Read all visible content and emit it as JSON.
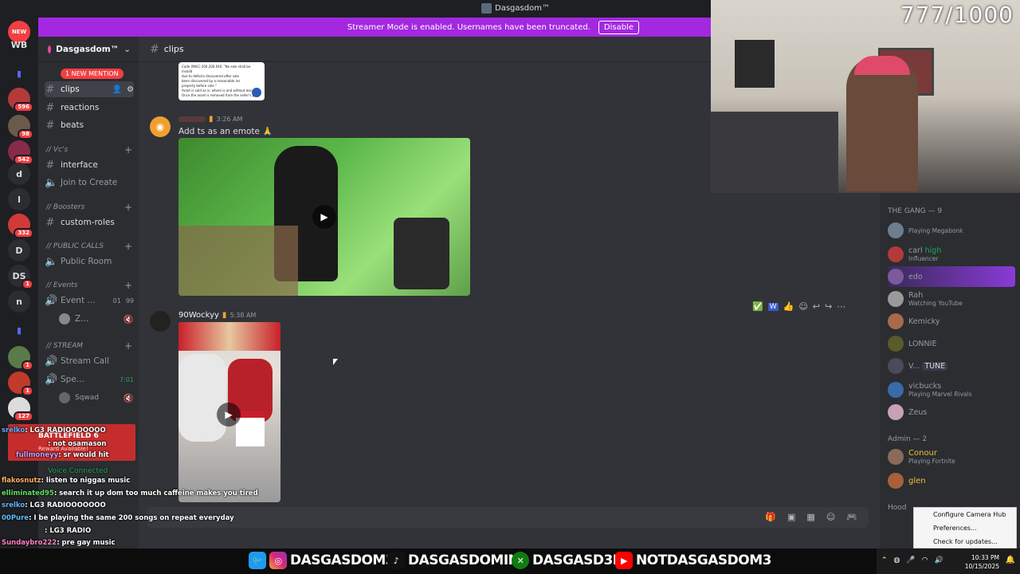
{
  "titlebar": {
    "title": "Dasgasdom™"
  },
  "banner": {
    "text": "Streamer Mode is enabled. Usernames have been truncated.",
    "button": "Disable"
  },
  "rail": {
    "new_label": "NEW",
    "items": [
      {
        "label": "WB",
        "badge": ""
      },
      {
        "label": "",
        "badge": "596"
      },
      {
        "label": "",
        "badge": "98"
      },
      {
        "label": "",
        "badge": "542"
      },
      {
        "label": "d",
        "badge": ""
      },
      {
        "label": "l",
        "badge": ""
      },
      {
        "label": "",
        "badge": "332"
      },
      {
        "label": "D",
        "badge": ""
      },
      {
        "label": "DS",
        "badge": "1"
      },
      {
        "label": "n",
        "badge": ""
      },
      {
        "label": "",
        "badge": "1"
      },
      {
        "label": "",
        "badge": "1"
      },
      {
        "label": "",
        "badge": "127"
      }
    ]
  },
  "server": {
    "name": "Dasgasdom™"
  },
  "new_mention": "1 NEW MENTION",
  "channels": {
    "clips": "clips",
    "reactions": "reactions",
    "beats": "beats",
    "cat_vcs": "// Vc's",
    "interface": "interface",
    "join_create": "Join to Create",
    "cat_boosters": "// Boosters",
    "custom_roles": "custom-roles",
    "cat_public": "// PUBLIC CALLS",
    "public_room": "Public Room",
    "cat_events": "// Events",
    "event": "Event ...",
    "event_count_a": "01",
    "event_count_b": "99",
    "event_user": "Z...",
    "cat_stream": "// STREAM",
    "stream_call": "Stream Call",
    "spe": "Spe...",
    "spe_time": "7:01",
    "sqwad": "Sqwad"
  },
  "chat_header": {
    "channel": "clips"
  },
  "messages": [
    {
      "time": "3:26 AM",
      "text": "Add ts as an emote 🙏"
    },
    {
      "user": "90Wockyy",
      "time": "5:38 AM"
    }
  ],
  "doc_snippet": [
    "Code (MAC) 200.200.040. \"No sale shall be invalid",
    "due to defects discovered after sale",
    "been discovered by a reasonable ins",
    "property before sale.\"",
    "Asset is sold as is, where is and without war",
    "Once the asset is removed from the seller's pr"
  ],
  "webcam": {
    "counter": "777/1000"
  },
  "members": {
    "gang_header": "THE GANG — 9",
    "gang": [
      {
        "name": "",
        "activity": "Playing Megabonk",
        "color": "#6d7e8e"
      },
      {
        "name": "carl",
        "tag": "high",
        "activity": "Influencer",
        "color": "#b23a3a"
      },
      {
        "name": "edo",
        "activity": "",
        "color": "#7a5a9a"
      },
      {
        "name": "Rah",
        "activity": "Watching YouTube",
        "color": "#9a9a9a"
      },
      {
        "name": "Kemicky",
        "activity": "",
        "color": "#a86a4a"
      },
      {
        "name": "LONNIE",
        "activity": "",
        "color": "#5a5a2a"
      },
      {
        "name": "V...",
        "tag": "TUNE",
        "activity": "",
        "color": "#4a4a5a"
      },
      {
        "name": "vicbucks",
        "activity": "Playing Marvel Rivals",
        "color": "#3a6aa8"
      },
      {
        "name": "Zeus",
        "activity": "",
        "color": "#c8a0b8"
      }
    ],
    "admin_header": "Admin — 2",
    "admins": [
      {
        "name": "Conour",
        "activity": "Playing Fortnite",
        "color": "#8a6a5a"
      },
      {
        "name": "glen",
        "activity": "",
        "color": "#a8603a"
      }
    ],
    "next_header": "Hood"
  },
  "context_menu": [
    "Configure Camera Hub",
    "Preferences...",
    "Check for updates..."
  ],
  "stream_chat": [
    {
      "user": "srelko",
      "text": ": LG3 RADIOOOOOOO"
    },
    {
      "user": "",
      "text": ": not osamason"
    },
    {
      "user": "fullmoneyy",
      "text": ": sr would hit"
    },
    {
      "user": "flakosnutz",
      "text": ": listen to niggas music"
    },
    {
      "user": "elliminated95",
      "text": ": search it up dom too much caffeine makes you tired"
    },
    {
      "user": "srelko",
      "text": ": LG3 RADIOOOOOOO"
    },
    {
      "user": "00Pure",
      "text": ": I be playing the same 200 songs on repeat everyday"
    },
    {
      "user": "",
      "text": ": LG3 RADIO"
    },
    {
      "user": "Sundaybro222",
      "text": ": pre gay music"
    }
  ],
  "alert": {
    "title": "BATTLEFIELD 6",
    "sub": "Reward Available!"
  },
  "voice_connected": "Voice Connected",
  "socials": {
    "twitter": "DASGASDOM3",
    "tiktok": "DASGASDOMINI",
    "xbox": "DASGASD3M",
    "youtube": "NOTDASGASDOM3"
  },
  "tray": {
    "time": "10:33 PM",
    "date": "10/15/2025"
  }
}
